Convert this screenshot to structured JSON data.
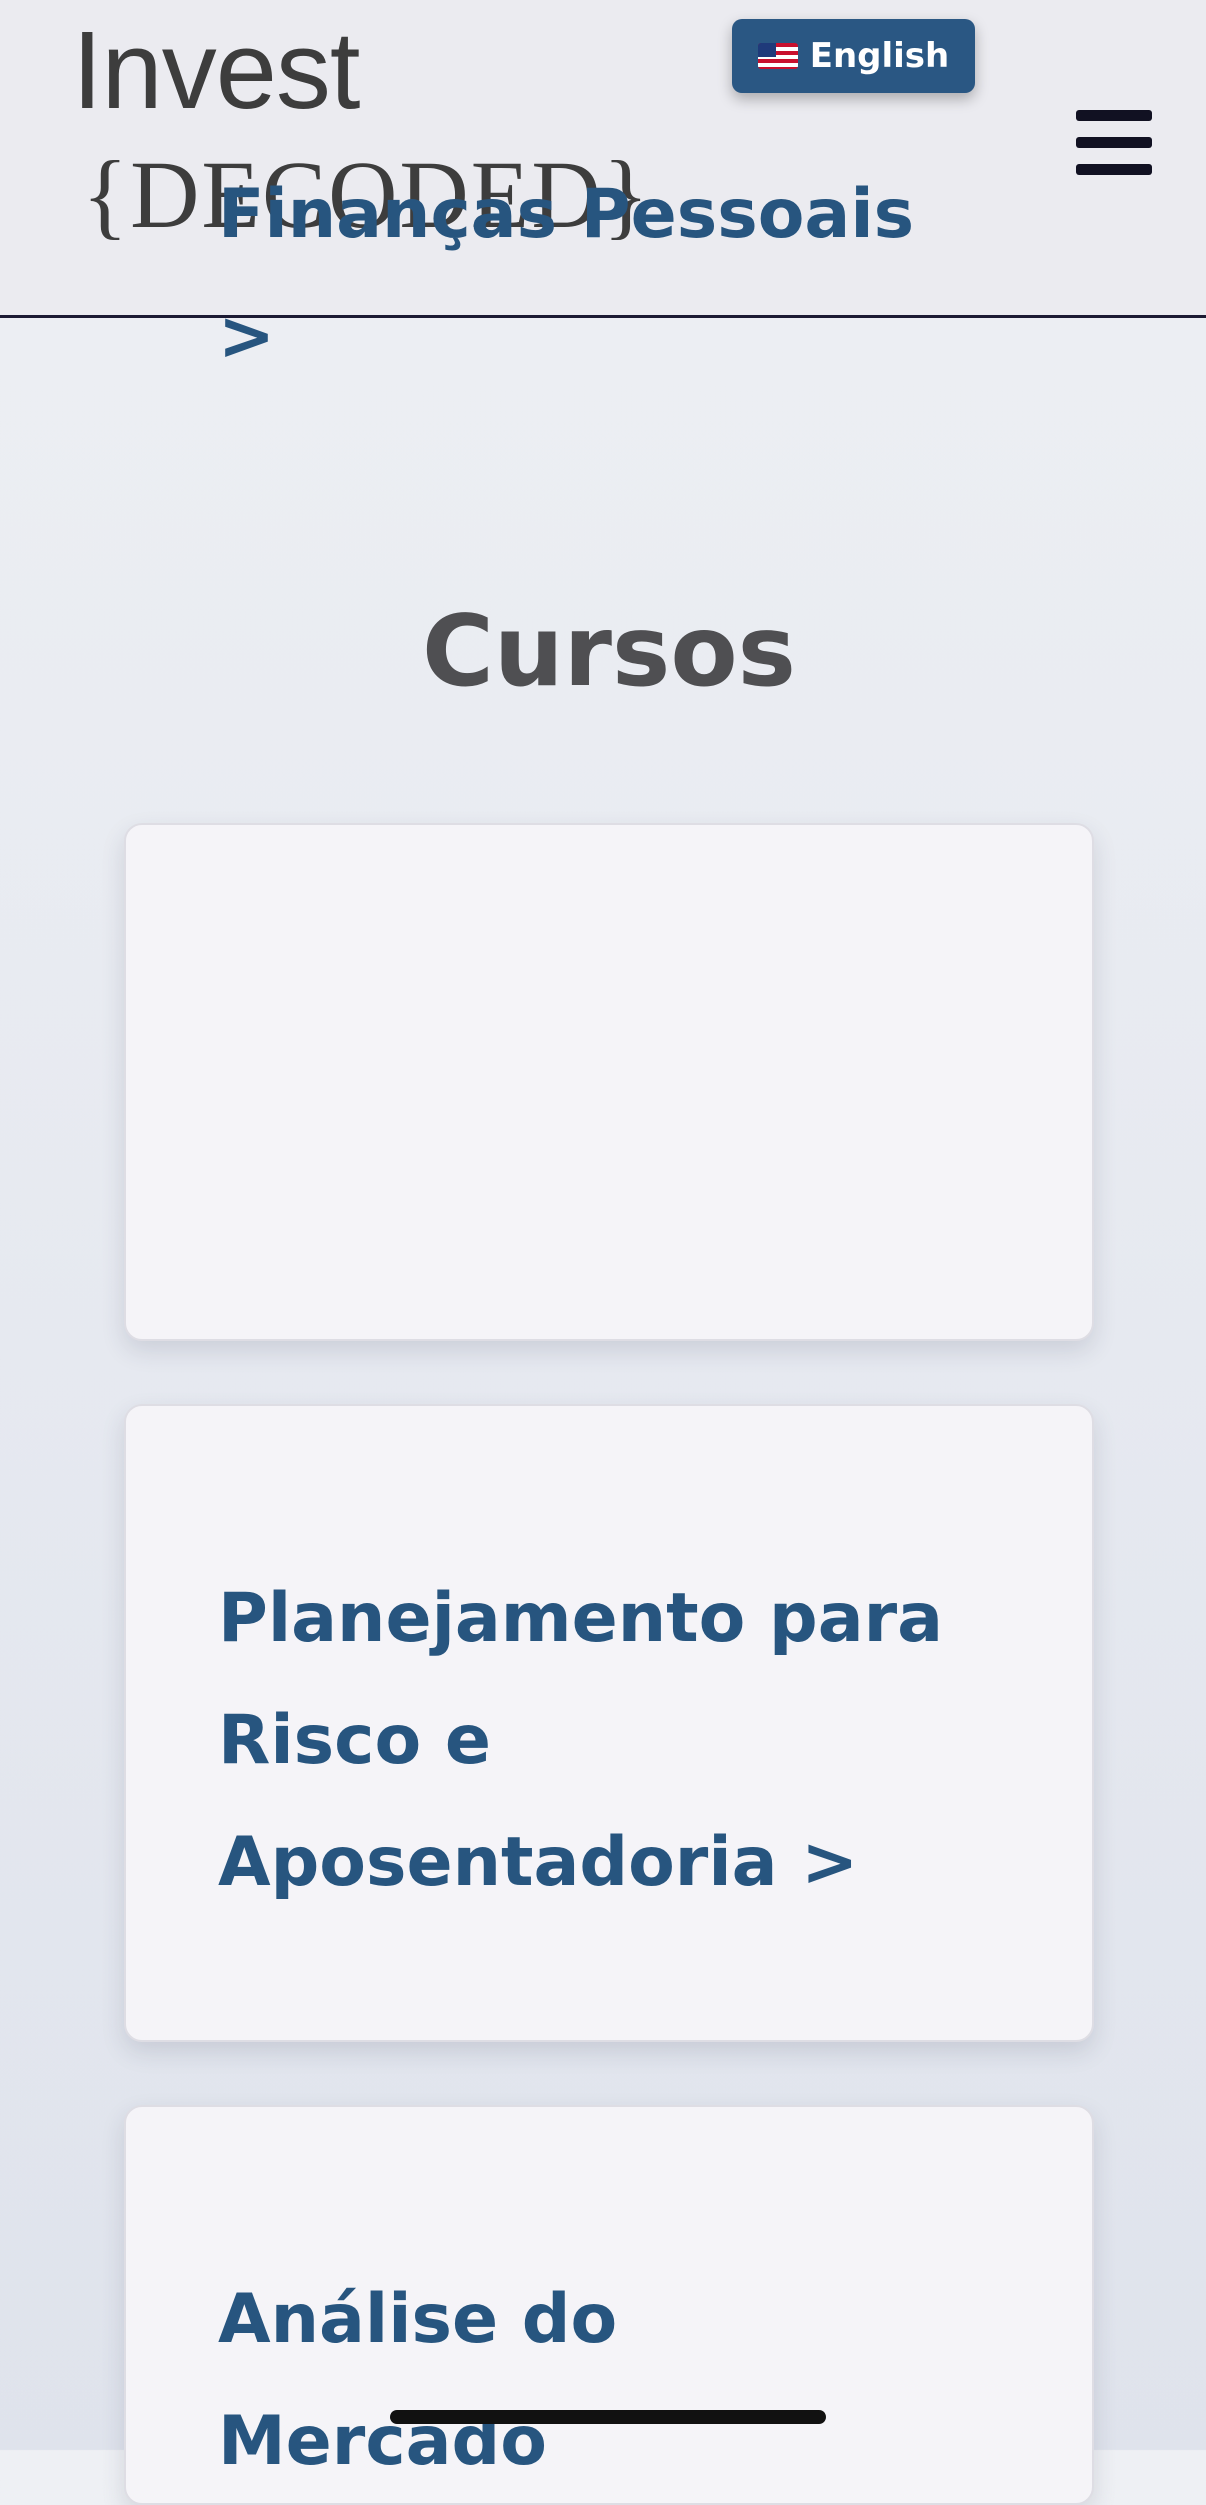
{
  "header": {
    "logo_line1": "Invest",
    "logo_line2": "{DECODED}",
    "language_button": {
      "flag_icon": "us-flag-icon",
      "label": "English"
    },
    "menu_icon": "hamburger-menu-icon"
  },
  "main": {
    "title": "Cursos",
    "courses": [
      {
        "label": "Finanças Pessoais\n  >"
      },
      {
        "label": "Planejamento para\nRisco e\nAposentadoria   >"
      },
      {
        "label": "Análise do\nMercado"
      }
    ]
  },
  "colors": {
    "accent": "#2a5783",
    "card_title": "#27557f",
    "header_bg": "#ebebf0",
    "title_text": "#4f4f52"
  }
}
